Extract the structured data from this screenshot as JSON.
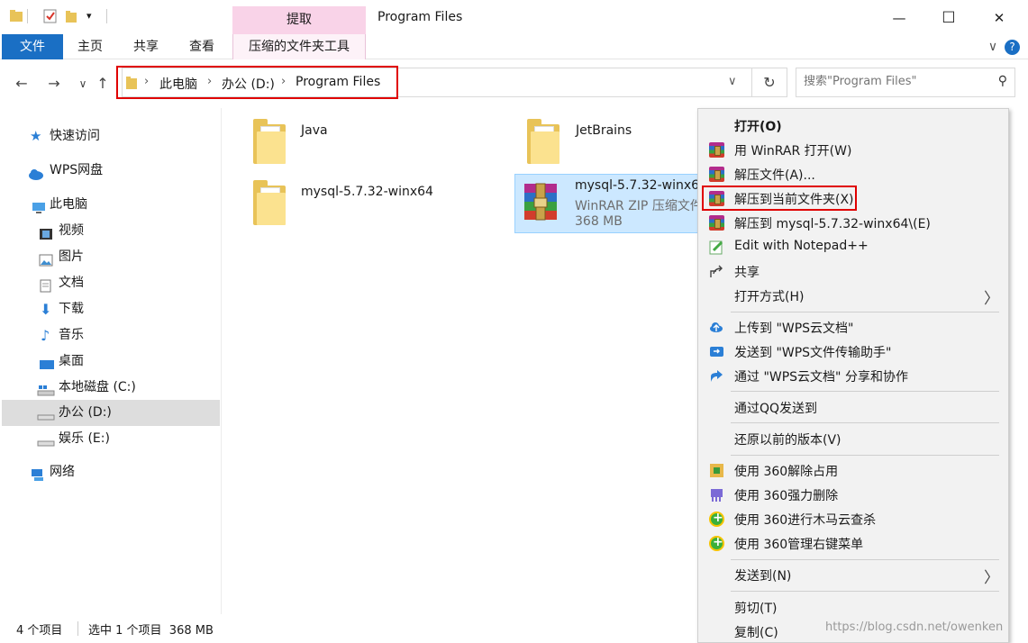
{
  "titlebar": {
    "tool_tab_title": "提取",
    "window_title": "Program Files",
    "minimize_glyph": "—",
    "maximize_glyph": "☐",
    "close_glyph": "✕",
    "quick_access_menu_glyph": "▾"
  },
  "ribbon": {
    "tabs": [
      "文件",
      "主页",
      "共享",
      "查看"
    ],
    "tool_tab": "压缩的文件夹工具",
    "expand_glyph": "∨",
    "help_glyph": "?"
  },
  "nav": {
    "back_glyph": "←",
    "forward_glyph": "→",
    "recent_glyph": "∨",
    "up_glyph": "↑",
    "breadcrumb": [
      "此电脑",
      "办公 (D:)",
      "Program Files"
    ],
    "breadcrumb_sep": "›",
    "dropdown_glyph": "∨",
    "refresh_glyph": "↻",
    "search_placeholder": "搜索\"Program Files\"",
    "search_glyph": "⚲"
  },
  "sidebar": {
    "quick_access": "快速访问",
    "wps_drive": "WPS网盘",
    "this_pc": "此电脑",
    "items": [
      "视频",
      "图片",
      "文档",
      "下载",
      "音乐",
      "桌面",
      "本地磁盘 (C:)",
      "办公 (D:)",
      "娱乐 (E:)"
    ],
    "network": "网络"
  },
  "files": {
    "java": "Java",
    "jetbrains": "JetBrains",
    "mysql_folder": "mysql-5.7.32-winx64",
    "archive_name": "mysql-5.7.32-winx6",
    "archive_type": "WinRAR ZIP 压缩文件",
    "archive_size": "368 MB"
  },
  "status": {
    "count": "4 个项目",
    "selection": "选中 1 个项目  368 MB"
  },
  "context_menu": {
    "open": "打开(O)",
    "winrar_open": "用 WinRAR 打开(W)",
    "extract_files": "解压文件(A)...",
    "extract_here": "解压到当前文件夹(X)",
    "extract_to": "解压到 mysql-5.7.32-winx64\\(E)",
    "notepad": "Edit with Notepad++",
    "share": "共享",
    "open_with": "打开方式(H)",
    "wps_upload": "上传到 \"WPS云文档\"",
    "wps_send": "发送到 \"WPS文件传输助手\"",
    "wps_share": "通过 \"WPS云文档\" 分享和协作",
    "qq_send": "通过QQ发送到",
    "restore": "还原以前的版本(V)",
    "unlock_360": "使用 360解除占用",
    "delete_360": "使用 360强力删除",
    "scan_360": "使用 360进行木马云查杀",
    "manage_360": "使用 360管理右键菜单",
    "send_to": "发送到(N)",
    "cut": "剪切(T)",
    "copy": "复制(C)",
    "submenu_glyph": "〉"
  },
  "watermark": "https://blog.csdn.net/owenken"
}
